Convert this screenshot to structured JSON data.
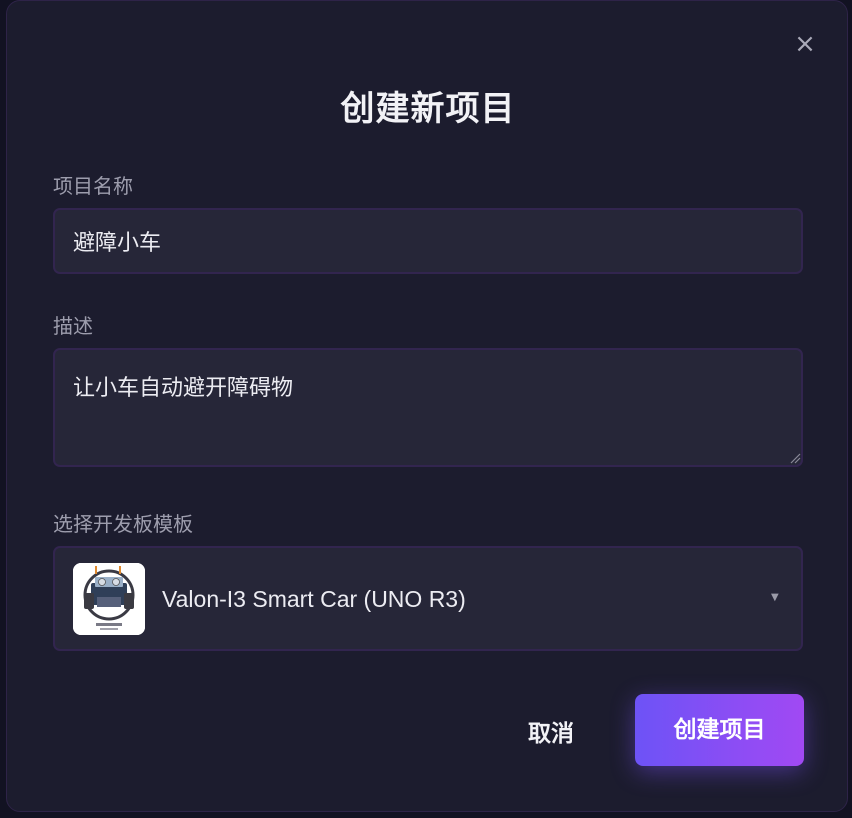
{
  "dialog": {
    "title": "创建新项目",
    "close_icon": "close-icon",
    "fields": {
      "name": {
        "label": "项目名称",
        "value": "避障小车"
      },
      "description": {
        "label": "描述",
        "value": "让小车自动避开障碍物"
      },
      "board": {
        "label": "选择开发板模板",
        "selected": "Valon-I3 Smart Car (UNO R3)",
        "thumbnail_icon": "smart-car-board-image",
        "arrow_icon": "dropdown-arrow-icon"
      }
    },
    "actions": {
      "cancel": "取消",
      "create": "创建项目"
    }
  },
  "colors": {
    "background": "#1c1c2e",
    "field_background": "#262638",
    "field_border": "#32254f",
    "accent_start": "#6d53f6",
    "accent_end": "#a149f3",
    "label": "#9d9dad",
    "text": "#ececf2"
  }
}
